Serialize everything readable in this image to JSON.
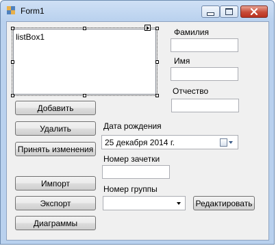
{
  "window": {
    "title": "Form1"
  },
  "listbox": {
    "items": [
      "listBox1"
    ]
  },
  "buttons": {
    "add": "Добавить",
    "delete": "Удалить",
    "apply": "Принять изменения",
    "import": "Импорт",
    "export": "Экспорт",
    "charts": "Диаграммы",
    "edit": "Редактировать"
  },
  "fields": {
    "surname_label": "Фамилия",
    "name_label": "Имя",
    "patronymic_label": "Отчество",
    "birthdate_label": "Дата рождения",
    "birthdate_value": "25  декабря  2014 г.",
    "record_book_label": "Номер зачетки",
    "group_label": "Номер группы"
  },
  "icons": {
    "app": "form-icon",
    "minimize": "minimize-icon",
    "maximize": "maximize-icon",
    "close": "close-icon",
    "calendar": "calendar-icon",
    "dropdown": "chevron-down-icon"
  },
  "colors": {
    "frame": "#b9d1ee",
    "client": "#f0f0f0",
    "close_button": "#c74b37"
  }
}
